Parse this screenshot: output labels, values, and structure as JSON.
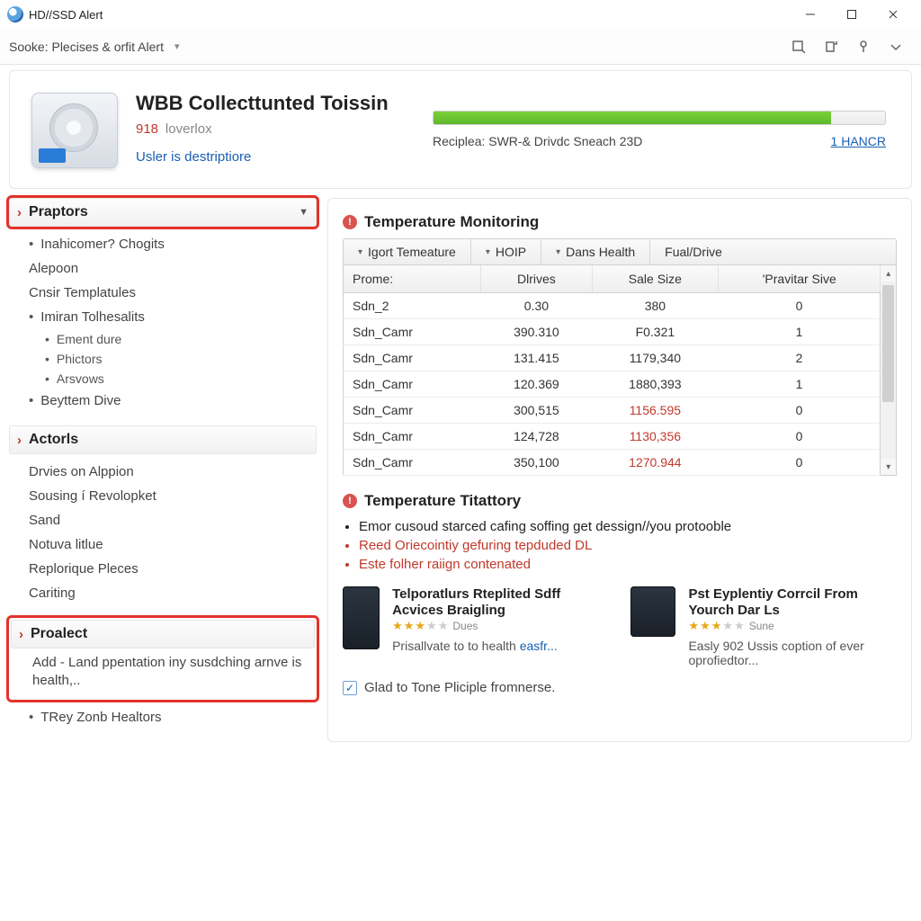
{
  "window": {
    "title": "HD//SSD Alert"
  },
  "toolbar": {
    "source_label": "Sooke: Plecises & orfit Alert"
  },
  "hero": {
    "title": "WBB Collecttunted Toissin",
    "metric_value": "918",
    "metric_label": "loverlox",
    "desc_link": "Usler is destriptiore",
    "progress_text": "Reciplea: SWR-& Drivdc Sneach 23D",
    "progress_link": "1 HANCR"
  },
  "sidebar": {
    "sections": [
      {
        "title": "Praptors",
        "has_dropdown": true,
        "highlight": true,
        "items": [
          {
            "text": "Inahicomer? Chogits",
            "bullet": true
          },
          {
            "text": "Alepoon"
          },
          {
            "text": "Cnsir Templatules"
          },
          {
            "text": "Imiran Tolhesalits",
            "bullet": true
          },
          {
            "text": "Ement dure",
            "sub": true,
            "bullet": true
          },
          {
            "text": "Phictors",
            "sub": true,
            "bullet": true
          },
          {
            "text": "Arsvows",
            "sub": true,
            "bullet": true
          },
          {
            "text": "Beyttem Dive",
            "bullet": true
          }
        ]
      },
      {
        "title": "Actorls",
        "items": [
          {
            "text": "Drvies on Alppion"
          },
          {
            "text": "Sousing í Revolopket"
          },
          {
            "text": "Sand"
          },
          {
            "text": "Notuva litlue"
          },
          {
            "text": "Replorique Pleces"
          },
          {
            "text": "Cariting"
          }
        ]
      },
      {
        "title": "Proalect",
        "highlight_block": true,
        "desc": "Add - Land ppentation iny susdching arnve is health,..",
        "after_items": [
          {
            "text": "TRey Zonb Healtors",
            "bullet": true
          }
        ]
      }
    ]
  },
  "content": {
    "monitor_title": "Temperature Monitoring",
    "tabs": [
      "Igort Temeature",
      "HOIP",
      "Dans Health",
      "Fual/Drive"
    ],
    "columns": [
      "Prome:",
      "Dlrives",
      "Sale Size",
      "'Pravitar Sive"
    ],
    "rows": [
      {
        "c0": "Sdn_2",
        "c1": "0.30",
        "c2": "380",
        "c3": "0",
        "red2": false
      },
      {
        "c0": "Sdn_Camr",
        "c1": "390.310",
        "c2": "F0.321",
        "c3": "1",
        "red2": false
      },
      {
        "c0": "Sdn_Camr",
        "c1": "131.415",
        "c2": "1179,340",
        "c3": "2",
        "red2": false
      },
      {
        "c0": "Sdn_Camr",
        "c1": "120.369",
        "c2": "1880,393",
        "c3": "1",
        "red2": false
      },
      {
        "c0": "Sdn_Camr",
        "c1": "300,515",
        "c2": "1156.595",
        "c3": "0",
        "red2": true
      },
      {
        "c0": "Sdn_Camr",
        "c1": "124,728",
        "c2": "1130,356",
        "c3": "0",
        "red2": true
      },
      {
        "c0": "Sdn_Camr",
        "c1": "350,100",
        "c2": "1270.944",
        "c3": "0",
        "red2": true
      }
    ],
    "titattory_title": "Temperature Titattory",
    "titattory": [
      {
        "text": "Emor cusoud starced cafing soffing get dessign//you protooble",
        "red": false
      },
      {
        "text": "Reed Oriecointiy gefuring tepduded DL",
        "red": true
      },
      {
        "text": "Este folher raiign contenated",
        "red": true
      }
    ],
    "cards": [
      {
        "title": "Telporatlurs Rteplited Sdff Acvices Braigling",
        "stars_label": "Dues",
        "blurb": "Prisallvate to to health ",
        "blurb_link": "easfr..."
      },
      {
        "title": "Pst Eyplentiy Corrcil From Yourch Dar Ls",
        "stars_label": "Sune",
        "blurb": "Easly 902 Ussis coption of ever oprofiedtor...",
        "blurb_link": ""
      }
    ],
    "footer_check": "Glad to Tone Pliciple fromnerse."
  }
}
